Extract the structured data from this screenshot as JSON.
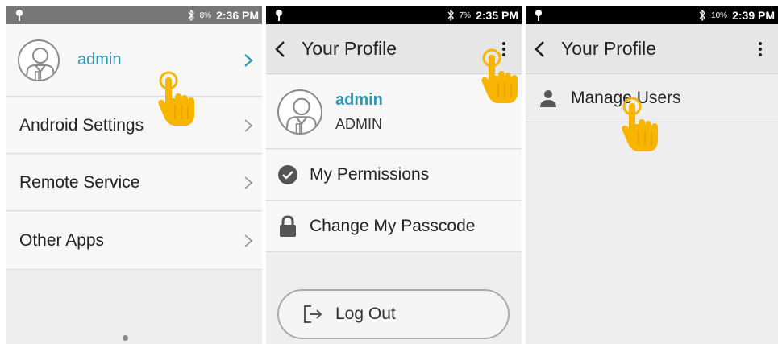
{
  "screen1": {
    "status": {
      "battery": "8%",
      "time": "2:36 PM"
    },
    "user": {
      "name": "admin"
    },
    "menu": [
      {
        "label": "Android Settings"
      },
      {
        "label": "Remote Service"
      },
      {
        "label": "Other Apps"
      }
    ]
  },
  "screen2": {
    "status": {
      "battery": "7%",
      "time": "2:35 PM"
    },
    "toolbar": {
      "title": "Your Profile"
    },
    "user": {
      "name": "admin",
      "role": "ADMIN"
    },
    "items": [
      {
        "label": "My Permissions",
        "icon": "check-circle-icon"
      },
      {
        "label": "Change My Passcode",
        "icon": "lock-icon"
      }
    ],
    "logout": {
      "label": "Log Out",
      "icon": "logout-icon"
    }
  },
  "screen3": {
    "status": {
      "battery": "10%",
      "time": "2:39 PM"
    },
    "toolbar": {
      "title": "Your Profile"
    },
    "menu": [
      {
        "label": "Manage Users",
        "icon": "person-icon"
      }
    ]
  },
  "colors": {
    "accent": "#2f95b3",
    "hand": "#f7b500"
  }
}
